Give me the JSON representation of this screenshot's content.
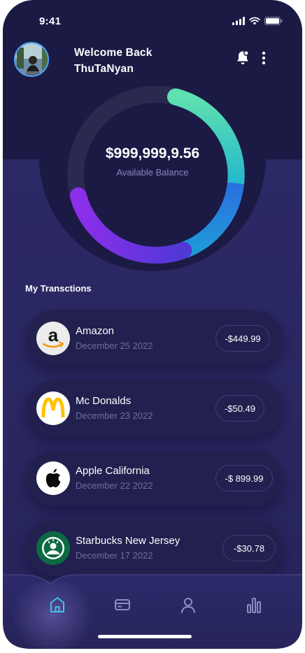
{
  "status_bar": {
    "time": "9:41"
  },
  "header": {
    "welcome_line1": "Welcome Back",
    "welcome_line2": "ThuTaNyan",
    "avatar_icon": "user-photo",
    "notification_icon": "bell-icon",
    "menu_icon": "more-vertical-icon"
  },
  "balance": {
    "amount": "$999,999,9.56",
    "label": "Available Balance"
  },
  "gauge": {
    "segments": [
      {
        "color_start": "#5fe0b0",
        "color_end": "#27c0c9"
      },
      {
        "color_start": "#2f7ee6",
        "color_end": "#1f5fd6"
      },
      {
        "color_start": "#5b3ad8",
        "color_end": "#8a2fe6"
      }
    ],
    "track_color": "#2a294f"
  },
  "transactions": {
    "title": "My Transctions",
    "items": [
      {
        "name": "Amazon",
        "date": "December 25 2022",
        "amount": "-$449.99",
        "logo": "amazon-logo"
      },
      {
        "name": "Mc Donalds",
        "date": "December 23 2022",
        "amount": "-$50.49",
        "logo": "mcdonalds-logo"
      },
      {
        "name": "Apple California",
        "date": "December 22 2022",
        "amount": "-$ 899.99",
        "logo": "apple-logo"
      },
      {
        "name": "Starbucks New Jersey",
        "date": "December 17 2022",
        "amount": "-$30.78",
        "logo": "starbucks-logo"
      }
    ]
  },
  "bottom_nav": {
    "items": [
      {
        "icon": "home-icon",
        "active": true
      },
      {
        "icon": "card-icon",
        "active": false
      },
      {
        "icon": "profile-icon",
        "active": false
      },
      {
        "icon": "chart-icon",
        "active": false
      }
    ],
    "active_color": "#3fc1e8",
    "inactive_color": "#8f8dbf"
  }
}
